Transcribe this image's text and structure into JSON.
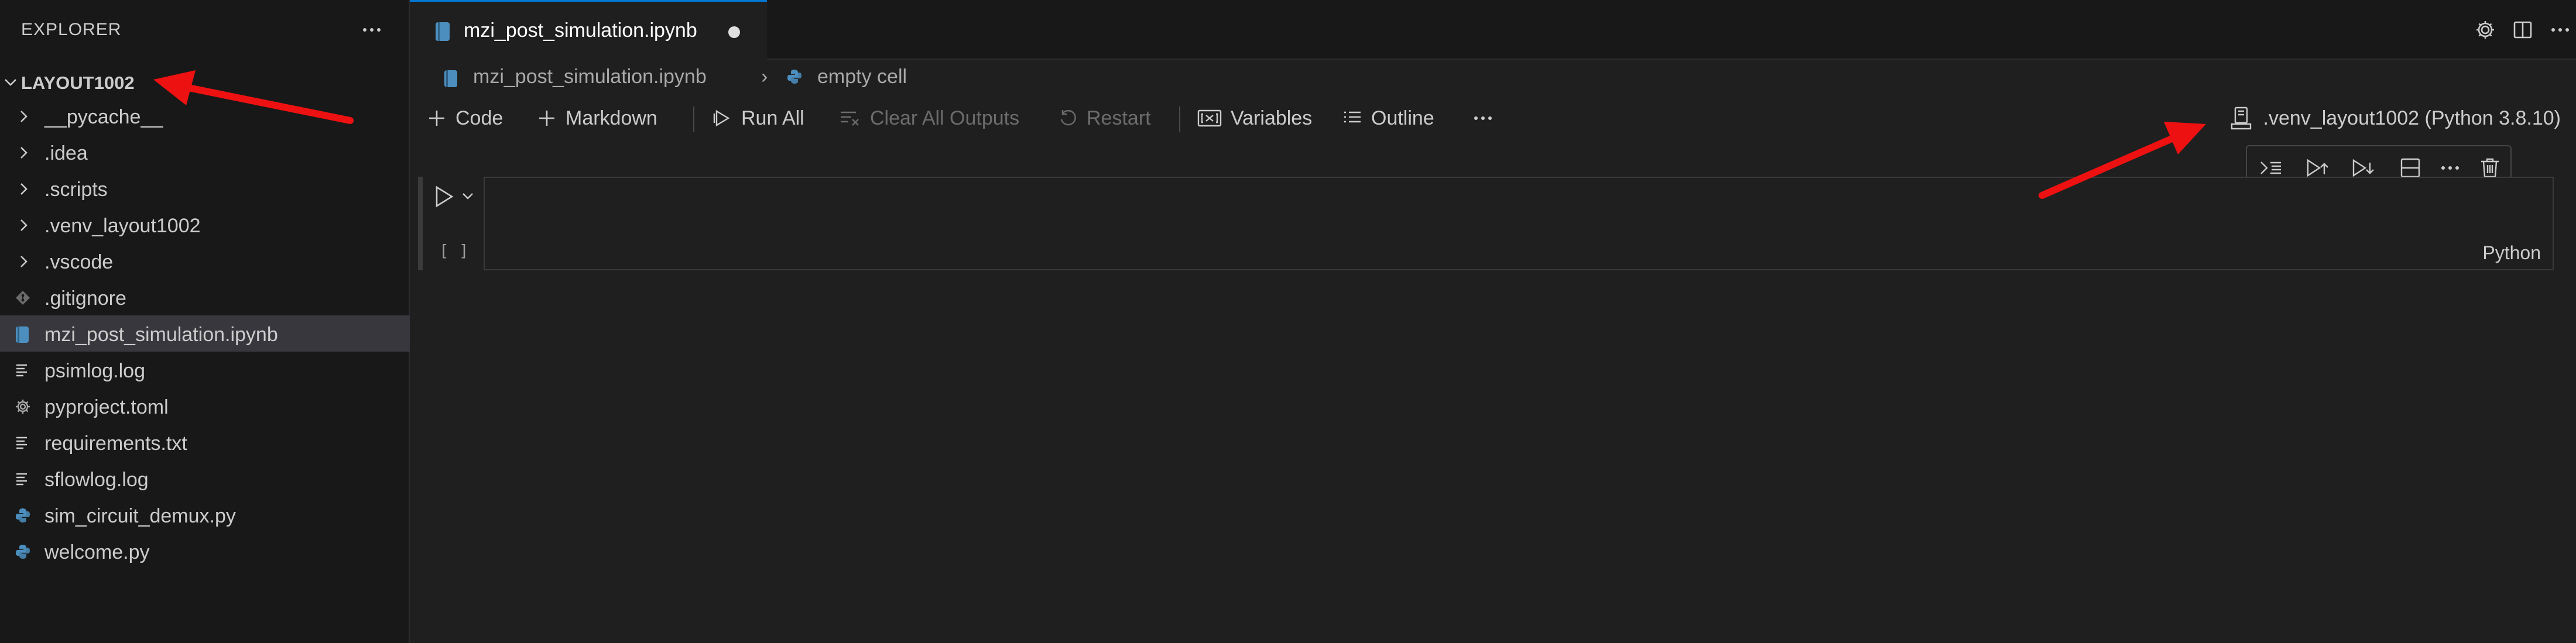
{
  "sidebar": {
    "header": "EXPLORER",
    "root_label": "LAYOUT1002",
    "items": [
      {
        "label": "__pycache__",
        "kind": "folder"
      },
      {
        "label": ".idea",
        "kind": "folder"
      },
      {
        "label": ".scripts",
        "kind": "folder"
      },
      {
        "label": ".venv_layout1002",
        "kind": "folder"
      },
      {
        "label": ".vscode",
        "kind": "folder"
      },
      {
        "label": ".gitignore",
        "kind": "git-file"
      },
      {
        "label": "mzi_post_simulation.ipynb",
        "kind": "notebook-file",
        "selected": true
      },
      {
        "label": "psimlog.log",
        "kind": "text-file"
      },
      {
        "label": "pyproject.toml",
        "kind": "gear-file"
      },
      {
        "label": "requirements.txt",
        "kind": "text-file"
      },
      {
        "label": "sflowlog.log",
        "kind": "text-file"
      },
      {
        "label": "sim_circuit_demux.py",
        "kind": "python-file"
      },
      {
        "label": "welcome.py",
        "kind": "python-file"
      }
    ]
  },
  "tab": {
    "label": "mzi_post_simulation.ipynb",
    "dirty": true
  },
  "breadcrumb": {
    "file": "mzi_post_simulation.ipynb",
    "separator": "›",
    "cell": "empty cell"
  },
  "toolbar": {
    "code": "Code",
    "markdown": "Markdown",
    "run_all": "Run All",
    "clear_all_outputs": "Clear All Outputs",
    "restart": "Restart",
    "variables": "Variables",
    "outline": "Outline"
  },
  "kernel": {
    "label": ".venv_layout1002 (Python 3.8.10)"
  },
  "cell": {
    "execution_count": "[ ]",
    "language": "Python"
  },
  "colors": {
    "sidebar_bg": "#181818",
    "editor_bg": "#1f1f1f",
    "selection_bg": "#37373d",
    "tab_accent": "#0078d4",
    "python_blue": "#4c8fbf",
    "annotation_red": "#ee1111"
  }
}
